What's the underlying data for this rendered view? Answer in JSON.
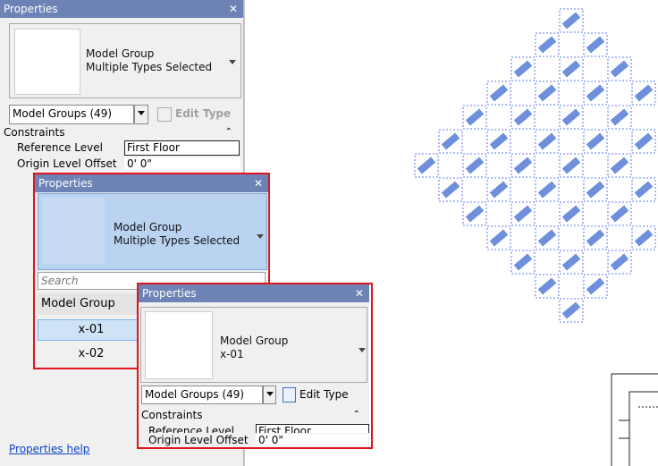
{
  "panel1": {
    "title": "Properties",
    "type_name": "Model Group",
    "type_sub": "Multiple Types Selected",
    "selector": "Model Groups (49)",
    "edit_type": "Edit Type",
    "section": "Constraints",
    "props": [
      {
        "label": "Reference Level",
        "value": "First Floor"
      },
      {
        "label": "Origin Level Offset",
        "value": "0'  0\""
      }
    ],
    "help_link": "Properties help"
  },
  "panel2": {
    "title": "Properties",
    "type_name": "Model Group",
    "type_sub": "Multiple Types Selected",
    "search_placeholder": "Search",
    "list_header": "Model Group",
    "items": [
      "x-01",
      "x-02"
    ]
  },
  "panel3": {
    "title": "Properties",
    "type_name": "Model Group",
    "type_sub": "x-01",
    "selector": "Model Groups (49)",
    "edit_type": "Edit Type",
    "section": "Constraints",
    "props": [
      {
        "label": "Reference Level",
        "value": "First Floor"
      },
      {
        "label": "Origin Level Offset",
        "value": "0'  0\""
      }
    ]
  },
  "colors": {
    "title_blue": "#6d83b5",
    "selected_blue": "#cfe3f7",
    "highlight_red": "#e0141e",
    "element_blue": "#6d8fdc"
  }
}
